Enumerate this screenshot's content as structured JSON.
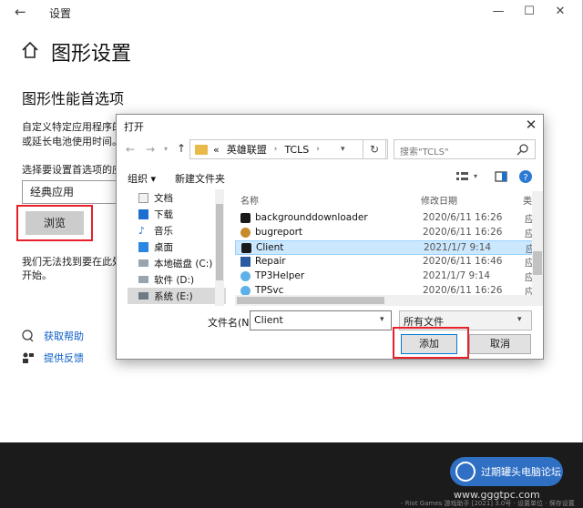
{
  "settings": {
    "window_title": "设置",
    "page_title": "图形设置",
    "section_title": "图形性能首选项",
    "desc_line1": "自定义特定应用程序的",
    "desc_line2": "或延长电池使用时间。",
    "select_label": "选择要设置首选项的应",
    "select_value": "经典应用",
    "browse_label": "浏览",
    "warn_line1": "我们无法找到要在此处",
    "warn_line2": "开始。",
    "help_link": "获取帮助",
    "feedback_link": "提供反馈"
  },
  "dialog": {
    "title": "打开",
    "breadcrumb": [
      "«",
      "英雄联盟",
      "TCLS"
    ],
    "search_placeholder": "搜索\"TCLS\"",
    "organize_label": "组织 ▾",
    "new_folder_label": "新建文件夹",
    "tree": [
      "文档",
      "下载",
      "音乐",
      "桌面",
      "本地磁盘 (C:)",
      "软件 (D:)",
      "系统 (E:)"
    ],
    "columns": {
      "name": "名称",
      "modified": "修改日期",
      "type": "类"
    },
    "files": [
      {
        "name": "backgrounddownloader",
        "date": "2020/6/11 16:26",
        "type": "应"
      },
      {
        "name": "bugreport",
        "date": "2020/6/11 16:26",
        "type": "应"
      },
      {
        "name": "Client",
        "date": "2021/1/7 9:14",
        "type": "应"
      },
      {
        "name": "Repair",
        "date": "2020/6/11 16:46",
        "type": "应"
      },
      {
        "name": "TP3Helper",
        "date": "2021/1/7 9:14",
        "type": "应"
      },
      {
        "name": "TPSvc",
        "date": "2020/6/11 16:26",
        "type": "应"
      }
    ],
    "filename_label": "文件名(N):",
    "filename_value": "Client",
    "filetype_value": "所有文件",
    "add_label": "添加",
    "cancel_label": "取消"
  },
  "watermark": {
    "text": "过期罐头电脑论坛",
    "url": "www.gggtpc.com"
  },
  "bottom_strip": "- Riot Games 游戏助手 [2021] 3.0号 · 设置单位 · 保存设置",
  "colors": {
    "highlight": "#e8202a",
    "link": "#0a5cc7",
    "selected_row": "#cce8ff",
    "watermark": "#2f6fc4"
  }
}
